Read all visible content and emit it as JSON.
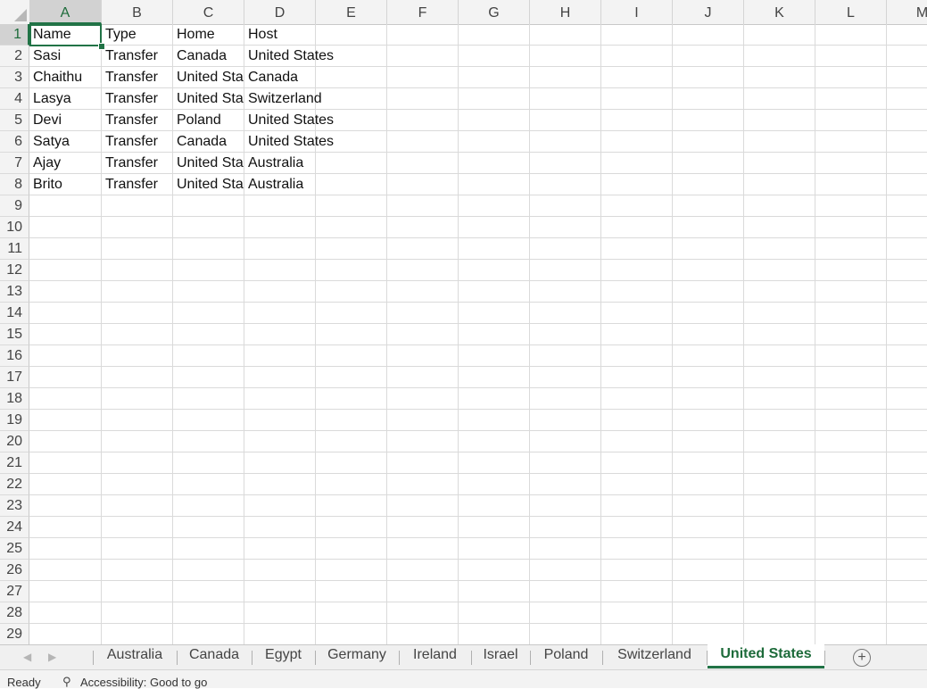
{
  "columns": [
    "A",
    "B",
    "C",
    "D",
    "E",
    "F",
    "G",
    "H",
    "I",
    "J",
    "K",
    "L",
    "M"
  ],
  "rows": [
    "1",
    "2",
    "3",
    "4",
    "5",
    "6",
    "7",
    "8",
    "9",
    "10",
    "11",
    "12",
    "13",
    "14",
    "15",
    "16",
    "17",
    "18",
    "19",
    "20",
    "21",
    "22",
    "23",
    "24",
    "25",
    "26",
    "27",
    "28",
    "29"
  ],
  "cells": [
    [
      "Name",
      "Type",
      "Home",
      "Host"
    ],
    [
      "Sasi",
      "Transfer",
      "Canada",
      "United States"
    ],
    [
      "Chaithu",
      "Transfer",
      "United Sta",
      "Canada"
    ],
    [
      "Lasya",
      "Transfer",
      "United Sta",
      "Switzerland"
    ],
    [
      "Devi",
      "Transfer",
      "Poland",
      "United States"
    ],
    [
      "Satya",
      "Transfer",
      "Canada",
      "United States"
    ],
    [
      "Ajay",
      "Transfer",
      "United Sta",
      "Australia"
    ],
    [
      "Brito",
      "Transfer",
      "United Sta",
      "Australia"
    ]
  ],
  "selected_cell": "A1",
  "tabs": [
    "Australia",
    "Canada",
    "Egypt",
    "Germany",
    "Ireland",
    "Israel",
    "Poland",
    "Switzerland",
    "United States"
  ],
  "active_tab": "United States",
  "add_sheet_glyph": "+",
  "status": {
    "ready": "Ready",
    "accessibility": "Accessibility: Good to go"
  },
  "icons": {
    "accessibility": "accessibility-icon",
    "prev": "tab-scroll-left-icon",
    "next": "tab-scroll-right-icon",
    "add": "add-sheet-icon"
  },
  "colors": {
    "accent": "#217346"
  }
}
